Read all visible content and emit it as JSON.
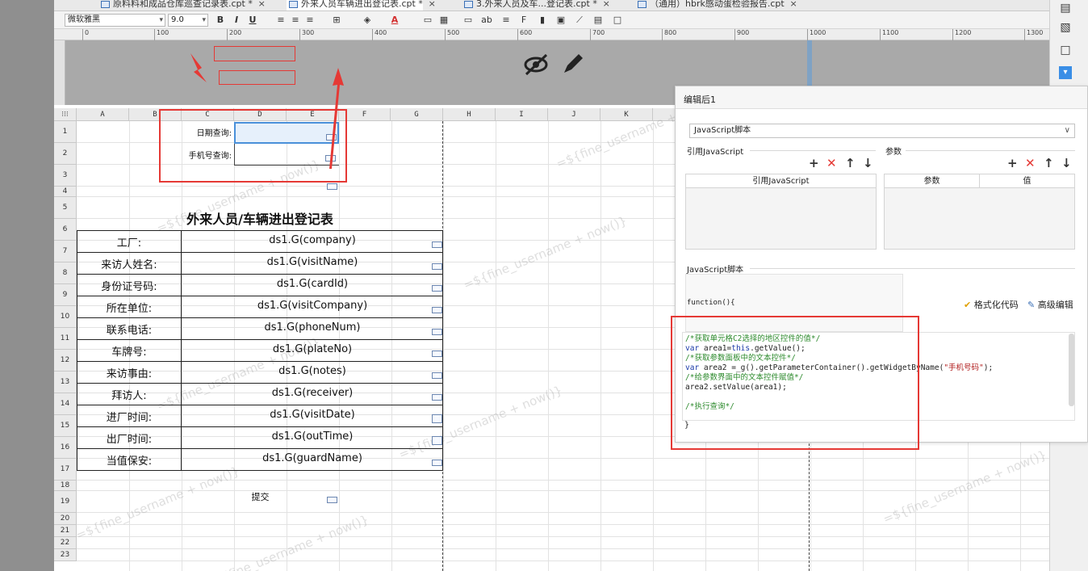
{
  "tabs": [
    {
      "label": "原料料和成品仓库巡查记录表.cpt *",
      "active": false
    },
    {
      "label": "外来人员车辆进出登记表.cpt *",
      "active": true
    },
    {
      "label": "3.外来人员及车...登记表.cpt *",
      "active": false
    },
    {
      "label": "（通用）hbrk感动蛋检验报告.cpt",
      "active": false
    }
  ],
  "toolbar": {
    "font_name": "微软雅黑",
    "font_size": "9.0",
    "bold": "B",
    "italic": "I",
    "underline": "U"
  },
  "ruler": {
    "ticks": [
      "0",
      "100",
      "200",
      "300",
      "400",
      "500",
      "600",
      "700",
      "800",
      "900",
      "1000",
      "1100",
      "1200",
      "1300"
    ]
  },
  "sheet": {
    "col_headers": [
      "A",
      "B",
      "C",
      "D",
      "E",
      "F",
      "G",
      "H",
      "I",
      "J",
      "K"
    ],
    "row_numbers": [
      "1",
      "2",
      "3",
      "4",
      "5",
      "6",
      "7",
      "8",
      "9",
      "10",
      "11",
      "12",
      "13",
      "14",
      "15",
      "16",
      "17",
      "18",
      "19",
      "20",
      "21",
      "22",
      "23"
    ],
    "param_labels": {
      "date_query": "日期查询:",
      "phone_query": "手机号查询:"
    },
    "title": "外来人员/车辆进出登记表",
    "rows": [
      {
        "label": "工厂:",
        "value": "ds1.G(company)"
      },
      {
        "label": "来访人姓名:",
        "value": "ds1.G(visitName)"
      },
      {
        "label": "身份证号码:",
        "value": "ds1.G(cardId)"
      },
      {
        "label": "所在单位:",
        "value": "ds1.G(visitCompany)"
      },
      {
        "label": "联系电话:",
        "value": "ds1.G(phoneNum)"
      },
      {
        "label": "车牌号:",
        "value": "ds1.G(plateNo)"
      },
      {
        "label": "来访事由:",
        "value": "ds1.G(notes)"
      },
      {
        "label": "拜访人:",
        "value": "ds1.G(receiver)"
      },
      {
        "label": "进厂时间:",
        "value": "ds1.G(visitDate)"
      },
      {
        "label": "出厂时间:",
        "value": "ds1.G(outTime)"
      },
      {
        "label": "当值保安:",
        "value": "ds1.G(guardName)"
      }
    ],
    "submit_label": "提交",
    "watermark": "=${fine_username + now()}"
  },
  "panel": {
    "title": "编辑后1",
    "script_type": "JavaScript脚本",
    "ref_js_label": "引用JavaScript",
    "params_label": "参数",
    "ref_js_column": "引用JavaScript",
    "param_column": "参数",
    "value_column": "值",
    "js_script_label": "JavaScript脚本",
    "function_sig": "function(){",
    "format_code": "格式化代码",
    "advanced_edit": "高级编辑",
    "code_lines": [
      {
        "type": "comment",
        "text": "/*获取单元格C2选择的地区控件的值*/"
      },
      {
        "type": "code1",
        "kw": "var",
        "rest": " area1=",
        "kw2": "this",
        "rest2": ".getValue();"
      },
      {
        "type": "comment",
        "text": "/*获取参数面板中的文本控件*/"
      },
      {
        "type": "code2",
        "kw": "var",
        "rest": " area2 =_g().getParameterContainer().getWidgetByName(",
        "str": "\"手机号码\"",
        "rest2": ");"
      },
      {
        "type": "comment",
        "text": "/*给参数界面中的文本控件赋值*/"
      },
      {
        "type": "plain",
        "text": "area2.setValue(area1);"
      },
      {
        "type": "plain",
        "text": ""
      },
      {
        "type": "comment",
        "text": "/*执行查询*/"
      }
    ],
    "closing_brace": "}"
  }
}
